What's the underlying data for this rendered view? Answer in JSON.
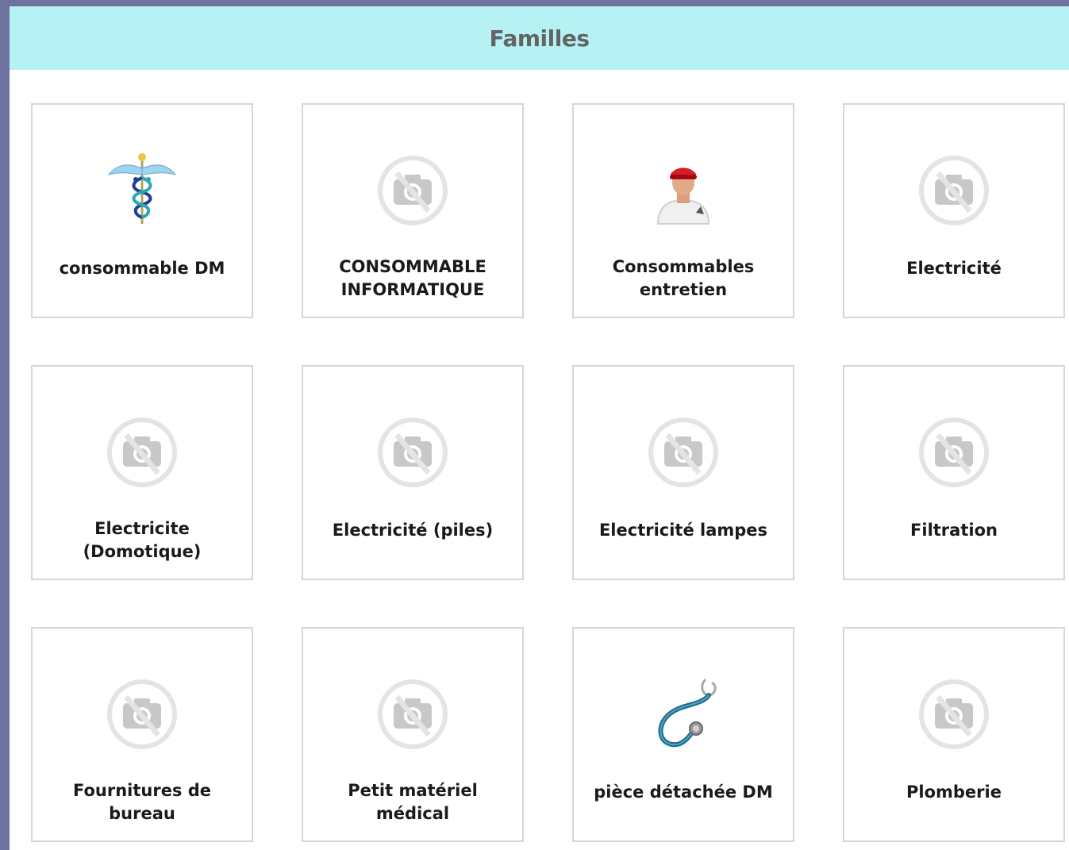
{
  "header": {
    "title": "Familles"
  },
  "families": [
    {
      "label": "consommable DM",
      "icon": "caduceus-icon"
    },
    {
      "label": "CONSOMMABLE INFORMATIQUE",
      "icon": "no-image-icon"
    },
    {
      "label": "Consommables entretien",
      "icon": "cleaner-person-icon"
    },
    {
      "label": "Electricité",
      "icon": "no-image-icon"
    },
    {
      "label": "Electricite (Domotique)",
      "icon": "no-image-icon"
    },
    {
      "label": "Electricité (piles)",
      "icon": "no-image-icon"
    },
    {
      "label": "Electricité lampes",
      "icon": "no-image-icon"
    },
    {
      "label": "Filtration",
      "icon": "no-image-icon"
    },
    {
      "label": "Fournitures de bureau",
      "icon": "no-image-icon"
    },
    {
      "label": "Petit matériel médical",
      "icon": "no-image-icon"
    },
    {
      "label": "pièce détachée DM",
      "icon": "stethoscope-icon"
    },
    {
      "label": "Plomberie",
      "icon": "no-image-icon"
    }
  ],
  "colors": {
    "background": "#6d739e",
    "header": "#b6f2f4",
    "tile_border": "#d6d6d6",
    "no_image_icon": "#c8c8c8"
  }
}
